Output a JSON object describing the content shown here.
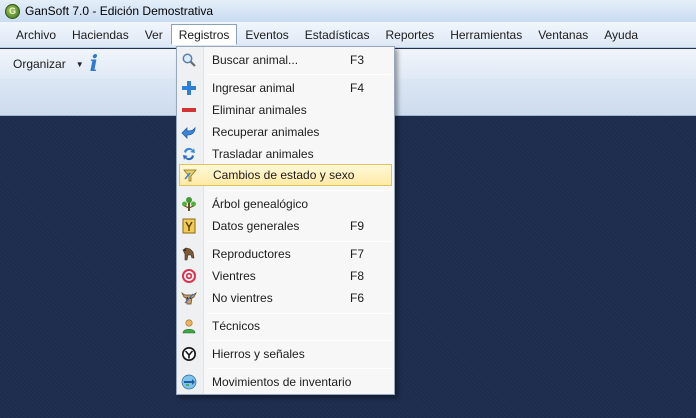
{
  "window": {
    "title": "GanSoft 7.0 - Edición Demostrativa",
    "icon": "gansoft-logo-icon"
  },
  "menubar": {
    "items": [
      {
        "label": "Archivo"
      },
      {
        "label": "Haciendas"
      },
      {
        "label": "Ver"
      },
      {
        "label": "Registros",
        "active": true
      },
      {
        "label": "Eventos"
      },
      {
        "label": "Estadísticas"
      },
      {
        "label": "Reportes"
      },
      {
        "label": "Herramientas"
      },
      {
        "label": "Ventanas"
      },
      {
        "label": "Ayuda"
      }
    ]
  },
  "toolbar": {
    "organize_label": "Organizar",
    "info_icon": "info-icon",
    "info_glyph": "i"
  },
  "dropdown": {
    "items": [
      {
        "label": "Buscar animal...",
        "shortcut": "F3",
        "icon": "magnifier-icon"
      },
      {
        "label": "Ingresar animal",
        "shortcut": "F4",
        "icon": "plus-icon"
      },
      {
        "label": "Eliminar animales",
        "shortcut": "",
        "icon": "minus-icon"
      },
      {
        "label": "Recuperar animales",
        "shortcut": "",
        "icon": "undo-arrow-icon"
      },
      {
        "label": "Trasladar animales",
        "shortcut": "",
        "icon": "transfer-icon"
      },
      {
        "label": "Cambios de estado y sexo",
        "shortcut": "",
        "icon": "state-change-icon",
        "highlighted": true
      },
      {
        "label": "Árbol genealógico",
        "shortcut": "",
        "icon": "tree-icon"
      },
      {
        "label": "Datos generales",
        "shortcut": "F9",
        "icon": "document-icon"
      },
      {
        "label": "Reproductores",
        "shortcut": "F7",
        "icon": "bull-icon"
      },
      {
        "label": "Vientres",
        "shortcut": "F8",
        "icon": "target-icon"
      },
      {
        "label": "No vientres",
        "shortcut": "F6",
        "icon": "cattle-head-icon"
      },
      {
        "label": "Técnicos",
        "shortcut": "",
        "icon": "person-icon"
      },
      {
        "label": "Hierros y señales",
        "shortcut": "",
        "icon": "brand-icon"
      },
      {
        "label": "Movimientos de inventario",
        "shortcut": "",
        "icon": "inventory-arrows-icon"
      }
    ]
  },
  "colors": {
    "workspace_bg": "#1d2c4c",
    "highlight_bg": "#ffeaa6",
    "highlight_border": "#e3c15b",
    "accent_blue": "#2d7ad6"
  }
}
